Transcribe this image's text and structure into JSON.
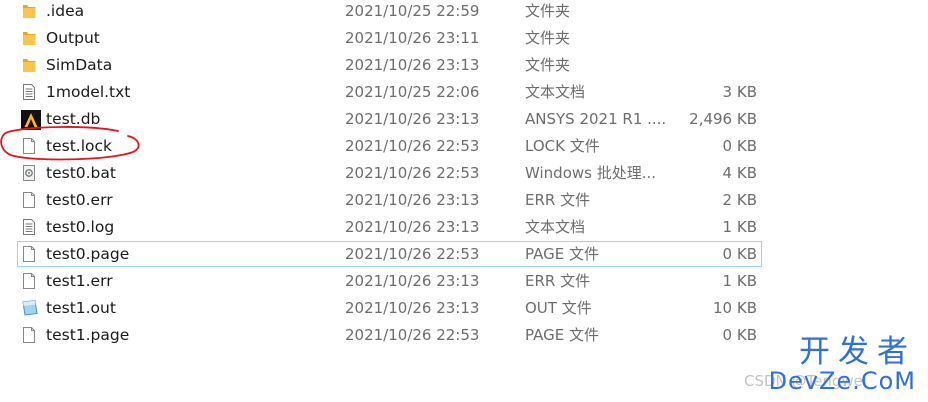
{
  "files": [
    {
      "name": ".idea",
      "date": "2021/10/25 22:59",
      "type": "文件夹",
      "size": "",
      "icon": "folder-icon"
    },
    {
      "name": "Output",
      "date": "2021/10/26 23:11",
      "type": "文件夹",
      "size": "",
      "icon": "folder-icon"
    },
    {
      "name": "SimData",
      "date": "2021/10/26 23:13",
      "type": "文件夹",
      "size": "",
      "icon": "folder-icon"
    },
    {
      "name": "1model.txt",
      "date": "2021/10/25 22:06",
      "type": "文本文档",
      "size": "3 KB",
      "icon": "text-file-icon"
    },
    {
      "name": "test.db",
      "date": "2021/10/26 23:13",
      "type": "ANSYS 2021 R1 ....",
      "size": "2,496 KB",
      "icon": "ansys-file-icon"
    },
    {
      "name": "test.lock",
      "date": "2021/10/26 22:53",
      "type": "LOCK 文件",
      "size": "0 KB",
      "icon": "blank-file-icon"
    },
    {
      "name": "test0.bat",
      "date": "2021/10/26 22:53",
      "type": "Windows 批处理...",
      "size": "4 KB",
      "icon": "batch-file-icon"
    },
    {
      "name": "test0.err",
      "date": "2021/10/26 23:13",
      "type": "ERR 文件",
      "size": "2 KB",
      "icon": "blank-file-icon"
    },
    {
      "name": "test0.log",
      "date": "2021/10/26 23:13",
      "type": "文本文档",
      "size": "1 KB",
      "icon": "text-file-icon"
    },
    {
      "name": "test0.page",
      "date": "2021/10/26 22:53",
      "type": "PAGE 文件",
      "size": "0 KB",
      "icon": "blank-file-icon"
    },
    {
      "name": "test1.err",
      "date": "2021/10/26 23:13",
      "type": "ERR 文件",
      "size": "1 KB",
      "icon": "blank-file-icon"
    },
    {
      "name": "test1.out",
      "date": "2021/10/26 23:13",
      "type": "OUT 文件",
      "size": "10 KB",
      "icon": "out-file-icon"
    },
    {
      "name": "test1.page",
      "date": "2021/10/26 22:53",
      "type": "PAGE 文件",
      "size": "0 KB",
      "icon": "blank-file-icon"
    }
  ],
  "hovered_row": "test0.page",
  "annotation_target": "test.lock",
  "annotation_color": "#e0161b",
  "watermark": {
    "cn": "开发者",
    "en": "DevZe.CoM",
    "faint": "CSDN @Tengwei",
    "color": "#2f6fde"
  },
  "colors": {
    "folder": "#f8c64a",
    "hover_border": "#99d1ff",
    "secondary_text": "#6d6d6d"
  }
}
